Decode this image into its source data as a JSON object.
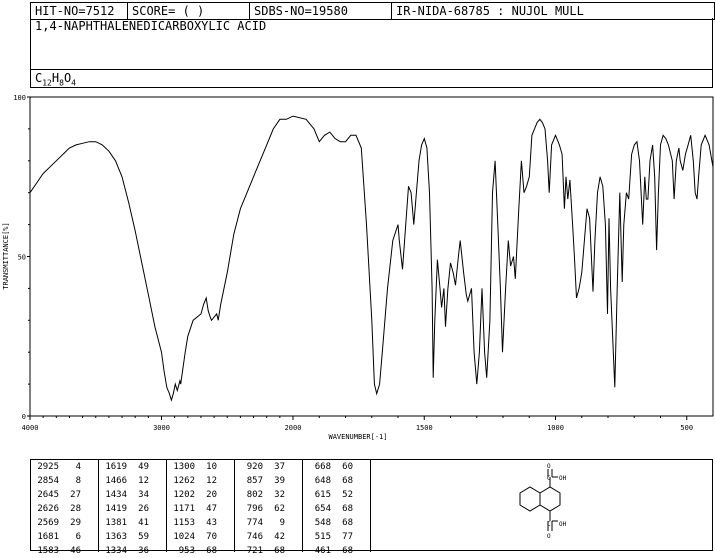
{
  "header": {
    "hit_no": "HIT-NO=7512",
    "score": "SCORE=  (   )",
    "sdbs_no": "SDBS-NO=19580",
    "ir": "IR-NIDA-68785 : NUJOL MULL"
  },
  "compound_name": "1,4-NAPHTHALENEDICARBOXYLIC ACID",
  "formula": {
    "c": "C",
    "c_n": "12",
    "h": "H",
    "h_n": "8",
    "o": "O",
    "o_n": "4"
  },
  "chart_data": {
    "type": "line",
    "xlabel": "WAVENUMBER[-1]",
    "ylabel": "TRANSMITTANCE[%]",
    "xlim": [
      4000,
      400
    ],
    "ylim": [
      0,
      100
    ],
    "x_ticks": [
      "4000",
      "3000",
      "2000",
      "1500",
      "1000",
      "500"
    ],
    "y_ticks": [
      "100",
      "50",
      "0"
    ],
    "series": [
      {
        "points": [
          [
            4000,
            70
          ],
          [
            3950,
            73
          ],
          [
            3900,
            76
          ],
          [
            3850,
            78
          ],
          [
            3800,
            80
          ],
          [
            3750,
            82
          ],
          [
            3700,
            84
          ],
          [
            3650,
            85
          ],
          [
            3600,
            85.5
          ],
          [
            3550,
            86
          ],
          [
            3500,
            86
          ],
          [
            3450,
            85
          ],
          [
            3400,
            83
          ],
          [
            3350,
            80
          ],
          [
            3300,
            75
          ],
          [
            3250,
            67
          ],
          [
            3200,
            58
          ],
          [
            3150,
            48
          ],
          [
            3100,
            38
          ],
          [
            3050,
            28
          ],
          [
            3000,
            20
          ],
          [
            2980,
            14
          ],
          [
            2960,
            9
          ],
          [
            2940,
            7
          ],
          [
            2925,
            5
          ],
          [
            2910,
            7
          ],
          [
            2895,
            10
          ],
          [
            2880,
            8
          ],
          [
            2860,
            11
          ],
          [
            2854,
            10
          ],
          [
            2840,
            14
          ],
          [
            2820,
            20
          ],
          [
            2800,
            25
          ],
          [
            2760,
            30
          ],
          [
            2700,
            32
          ],
          [
            2680,
            35
          ],
          [
            2660,
            37
          ],
          [
            2645,
            33
          ],
          [
            2630,
            31
          ],
          [
            2620,
            30
          ],
          [
            2600,
            31
          ],
          [
            2580,
            32
          ],
          [
            2569,
            30
          ],
          [
            2550,
            35
          ],
          [
            2500,
            45
          ],
          [
            2450,
            57
          ],
          [
            2400,
            65
          ],
          [
            2350,
            70
          ],
          [
            2300,
            75
          ],
          [
            2250,
            80
          ],
          [
            2200,
            85
          ],
          [
            2150,
            90
          ],
          [
            2100,
            93
          ],
          [
            2050,
            93
          ],
          [
            2000,
            94
          ],
          [
            1950,
            93
          ],
          [
            1920,
            90
          ],
          [
            1900,
            86
          ],
          [
            1880,
            88
          ],
          [
            1860,
            89
          ],
          [
            1840,
            87
          ],
          [
            1820,
            86
          ],
          [
            1800,
            86
          ],
          [
            1780,
            88
          ],
          [
            1760,
            88
          ],
          [
            1740,
            84
          ],
          [
            1720,
            60
          ],
          [
            1700,
            30
          ],
          [
            1690,
            10
          ],
          [
            1681,
            7
          ],
          [
            1670,
            10
          ],
          [
            1660,
            20
          ],
          [
            1640,
            40
          ],
          [
            1620,
            55
          ],
          [
            1600,
            60
          ],
          [
            1595,
            55
          ],
          [
            1583,
            46
          ],
          [
            1575,
            55
          ],
          [
            1560,
            72
          ],
          [
            1550,
            70
          ],
          [
            1540,
            60
          ],
          [
            1535,
            65
          ],
          [
            1530,
            70
          ],
          [
            1520,
            80
          ],
          [
            1510,
            85
          ],
          [
            1500,
            87
          ],
          [
            1490,
            84
          ],
          [
            1480,
            70
          ],
          [
            1470,
            40
          ],
          [
            1466,
            12
          ],
          [
            1460,
            30
          ],
          [
            1450,
            49
          ],
          [
            1440,
            40
          ],
          [
            1434,
            34
          ],
          [
            1425,
            40
          ],
          [
            1419,
            28
          ],
          [
            1410,
            40
          ],
          [
            1400,
            48
          ],
          [
            1390,
            45
          ],
          [
            1381,
            41
          ],
          [
            1370,
            50
          ],
          [
            1363,
            55
          ],
          [
            1350,
            45
          ],
          [
            1340,
            38
          ],
          [
            1334,
            36
          ],
          [
            1320,
            40
          ],
          [
            1310,
            20
          ],
          [
            1300,
            10
          ],
          [
            1290,
            20
          ],
          [
            1280,
            40
          ],
          [
            1270,
            20
          ],
          [
            1262,
            12
          ],
          [
            1250,
            30
          ],
          [
            1240,
            70
          ],
          [
            1230,
            80
          ],
          [
            1220,
            60
          ],
          [
            1210,
            40
          ],
          [
            1202,
            20
          ],
          [
            1190,
            40
          ],
          [
            1180,
            55
          ],
          [
            1171,
            47
          ],
          [
            1160,
            50
          ],
          [
            1153,
            43
          ],
          [
            1140,
            65
          ],
          [
            1130,
            80
          ],
          [
            1120,
            70
          ],
          [
            1110,
            72
          ],
          [
            1100,
            75
          ],
          [
            1090,
            88
          ],
          [
            1080,
            90
          ],
          [
            1070,
            92
          ],
          [
            1060,
            93
          ],
          [
            1050,
            92
          ],
          [
            1040,
            90
          ],
          [
            1030,
            80
          ],
          [
            1024,
            70
          ],
          [
            1015,
            85
          ],
          [
            1000,
            88
          ],
          [
            985,
            85
          ],
          [
            975,
            82
          ],
          [
            966,
            65
          ],
          [
            960,
            75
          ],
          [
            953,
            68
          ],
          [
            945,
            74
          ],
          [
            935,
            60
          ],
          [
            928,
            50
          ],
          [
            920,
            37
          ],
          [
            910,
            40
          ],
          [
            900,
            45
          ],
          [
            890,
            55
          ],
          [
            880,
            65
          ],
          [
            870,
            62
          ],
          [
            857,
            39
          ],
          [
            850,
            55
          ],
          [
            840,
            70
          ],
          [
            830,
            75
          ],
          [
            820,
            72
          ],
          [
            810,
            60
          ],
          [
            802,
            32
          ],
          [
            796,
            62
          ],
          [
            790,
            40
          ],
          [
            780,
            20
          ],
          [
            774,
            9
          ],
          [
            765,
            40
          ],
          [
            755,
            70
          ],
          [
            746,
            42
          ],
          [
            740,
            60
          ],
          [
            730,
            70
          ],
          [
            721,
            68
          ],
          [
            710,
            82
          ],
          [
            700,
            85
          ],
          [
            690,
            86
          ],
          [
            680,
            80
          ],
          [
            668,
            60
          ],
          [
            660,
            75
          ],
          [
            654,
            68
          ],
          [
            648,
            68
          ],
          [
            640,
            80
          ],
          [
            630,
            85
          ],
          [
            622,
            75
          ],
          [
            615,
            52
          ],
          [
            608,
            70
          ],
          [
            600,
            85
          ],
          [
            590,
            88
          ],
          [
            580,
            87
          ],
          [
            570,
            85
          ],
          [
            555,
            80
          ],
          [
            548,
            68
          ],
          [
            540,
            80
          ],
          [
            530,
            84
          ],
          [
            525,
            80
          ],
          [
            515,
            77
          ],
          [
            505,
            82
          ],
          [
            495,
            85
          ],
          [
            485,
            88
          ],
          [
            475,
            80
          ],
          [
            468,
            70
          ],
          [
            461,
            68
          ],
          [
            455,
            75
          ],
          [
            445,
            85
          ],
          [
            430,
            88
          ],
          [
            415,
            85
          ],
          [
            400,
            78
          ]
        ]
      }
    ],
    "peak_table": [
      [
        [
          2925,
          4
        ],
        [
          2854,
          8
        ],
        [
          2645,
          27
        ],
        [
          2626,
          28
        ],
        [
          2569,
          29
        ],
        [
          1681,
          6
        ],
        [
          1583,
          46
        ]
      ],
      [
        [
          1619,
          49
        ],
        [
          1466,
          12
        ],
        [
          1434,
          34
        ],
        [
          1419,
          26
        ],
        [
          1381,
          41
        ],
        [
          1363,
          59
        ],
        [
          1334,
          36
        ]
      ],
      [
        [
          1300,
          10
        ],
        [
          1262,
          12
        ],
        [
          1202,
          20
        ],
        [
          1171,
          47
        ],
        [
          1153,
          43
        ],
        [
          1024,
          70
        ],
        [
          953,
          68
        ]
      ],
      [
        [
          920,
          37
        ],
        [
          857,
          39
        ],
        [
          802,
          32
        ],
        [
          796,
          62
        ],
        [
          774,
          9
        ],
        [
          746,
          42
        ],
        [
          721,
          68
        ]
      ],
      [
        [
          668,
          60
        ],
        [
          648,
          68
        ],
        [
          615,
          52
        ],
        [
          654,
          68
        ],
        [
          548,
          68
        ],
        [
          515,
          77
        ],
        [
          461,
          68
        ]
      ]
    ],
    "structure_labels": {
      "top": "O",
      "top_oh": "OH",
      "top_c": "C",
      "bot_c": "C",
      "bot_o": "O",
      "bot_oh": "OH"
    }
  }
}
